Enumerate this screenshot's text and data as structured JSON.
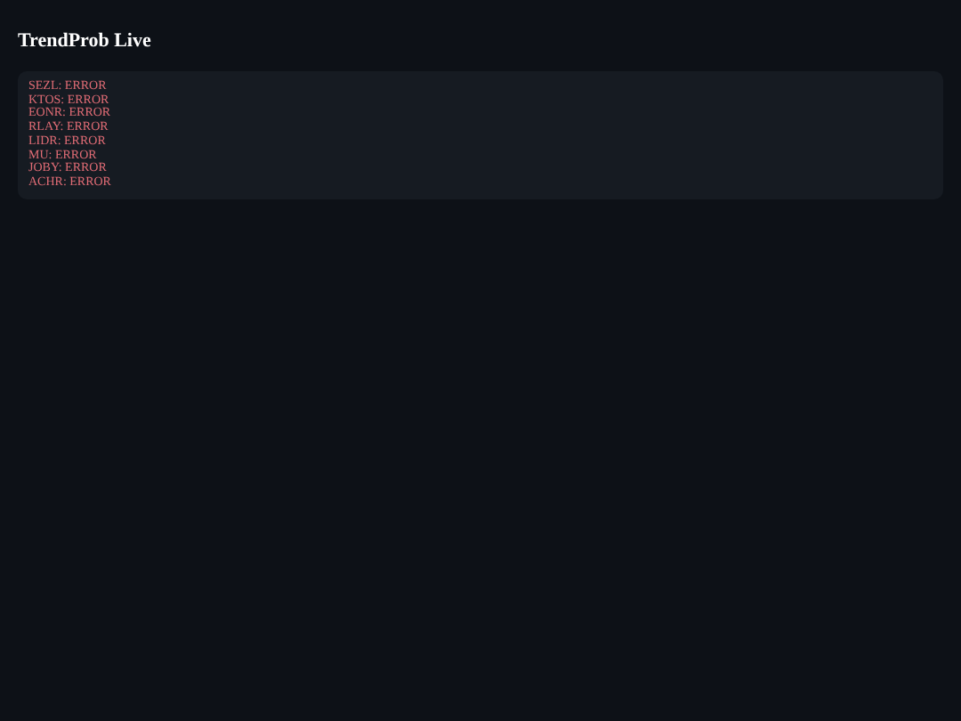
{
  "title": "TrendProb Live",
  "errors": [
    {
      "text": "SEZL: ERROR"
    },
    {
      "text": "KTOS: ERROR"
    },
    {
      "text": "EONR: ERROR"
    },
    {
      "text": "RLAY: ERROR"
    },
    {
      "text": "LIDR: ERROR"
    },
    {
      "text": "MU: ERROR"
    },
    {
      "text": "JOBY: ERROR"
    },
    {
      "text": "ACHR: ERROR"
    }
  ]
}
